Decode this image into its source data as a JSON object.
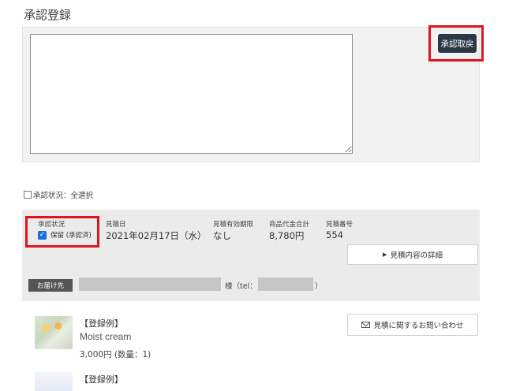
{
  "page": {
    "title": "承認登録"
  },
  "approval": {
    "comment_value": "",
    "revoke_label": "承認取戻"
  },
  "select_all": {
    "label": "承認状況：全選択",
    "checked": false
  },
  "order": {
    "labels": {
      "status": "承認状況",
      "estimate_date": "見積日",
      "valid_until": "見積有効期限",
      "subtotal": "商品代金合計",
      "estimate_no": "見積番号"
    },
    "status": {
      "checked": true,
      "text": "保留 (承認済)"
    },
    "estimate_date": "2021年02月17日（水）",
    "valid_until": "なし",
    "subtotal": "8,780円",
    "estimate_no": "554",
    "detail_button": "見積内容の詳細"
  },
  "delivery": {
    "badge": "お届け先",
    "sama": "様（tel：",
    "close": "）"
  },
  "inquiry_button": "見積に関するお問い合わせ",
  "items": [
    {
      "tag": "【登録例】",
      "name": "Moist cream",
      "price": "3,000円 (数量：1)"
    },
    {
      "tag": "【登録例】",
      "name": ""
    }
  ],
  "colors": {
    "highlight": "#e0141e",
    "revoke_button": "#2b3947",
    "checkbox": "#1a6fd6",
    "badge": "#555555"
  },
  "icons": [
    "resize-grip-icon",
    "checkbox-empty-icon",
    "checkbox-checked-icon",
    "triangle-right-icon",
    "mail-icon"
  ]
}
